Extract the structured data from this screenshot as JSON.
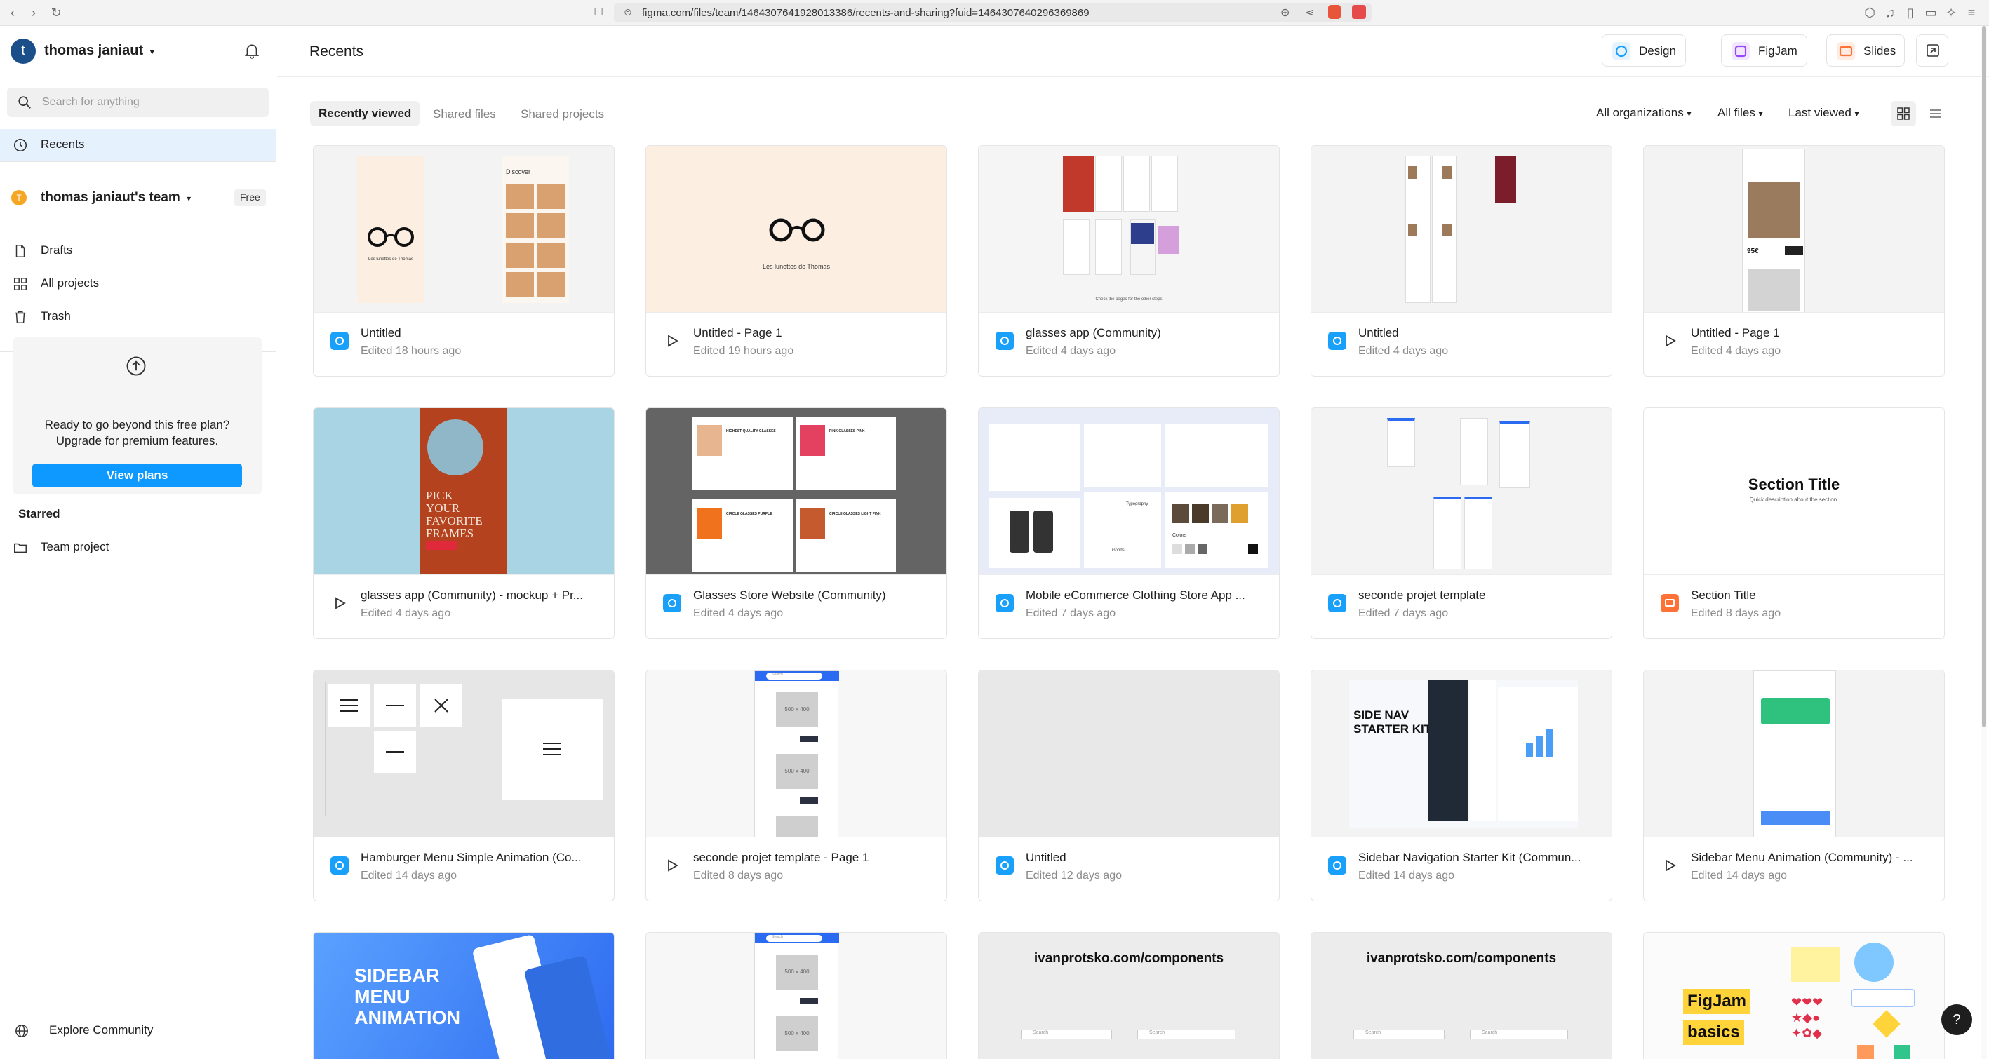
{
  "browser": {
    "url": "figma.com/files/team/1464307641928013386/recents-and-sharing?fuid=1464307640296369869"
  },
  "sidebar": {
    "user_initial": "t",
    "user_name": "thomas janiaut",
    "search_placeholder": "Search for anything",
    "recents_label": "Recents",
    "team_initial": "T",
    "team_name": "thomas janiaut's team",
    "team_badge": "Free",
    "items": [
      {
        "label": "Drafts"
      },
      {
        "label": "All projects"
      },
      {
        "label": "Trash"
      }
    ],
    "upgrade": {
      "line1": "Ready to go beyond this free plan?",
      "line2": "Upgrade for premium features.",
      "button": "View plans"
    },
    "starred_heading": "Starred",
    "starred_items": [
      {
        "label": "Team project"
      }
    ],
    "explore_label": "Explore Community"
  },
  "header": {
    "title": "Recents",
    "buttons": [
      {
        "label": "Design",
        "color": "#18a0fb"
      },
      {
        "label": "FigJam",
        "color": "#9747ff"
      },
      {
        "label": "Slides",
        "color": "#ff7237"
      }
    ]
  },
  "tabs": [
    {
      "label": "Recently viewed",
      "active": true
    },
    {
      "label": "Shared files",
      "active": false
    },
    {
      "label": "Shared projects",
      "active": false
    }
  ],
  "filters": {
    "org": "All organizations",
    "files": "All files",
    "sort": "Last viewed"
  },
  "files": [
    {
      "title": "Untitled",
      "edited": "Edited 18 hours ago",
      "kind": "design"
    },
    {
      "title": "Untitled - Page 1",
      "edited": "Edited 19 hours ago",
      "kind": "prototype"
    },
    {
      "title": "glasses app (Community)",
      "edited": "Edited 4 days ago",
      "kind": "design"
    },
    {
      "title": "Untitled",
      "edited": "Edited 4 days ago",
      "kind": "design"
    },
    {
      "title": "Untitled - Page 1",
      "edited": "Edited 4 days ago",
      "kind": "prototype"
    },
    {
      "title": "glasses app (Community) - mockup + Pr...",
      "edited": "Edited 4 days ago",
      "kind": "prototype"
    },
    {
      "title": "Glasses Store Website (Community)",
      "edited": "Edited 4 days ago",
      "kind": "design"
    },
    {
      "title": "Mobile eCommerce Clothing Store App ...",
      "edited": "Edited 7 days ago",
      "kind": "design"
    },
    {
      "title": "seconde projet template",
      "edited": "Edited 7 days ago",
      "kind": "design"
    },
    {
      "title": "Section Title",
      "edited": "Edited 8 days ago",
      "kind": "slides"
    },
    {
      "title": "Hamburger Menu Simple Animation (Co...",
      "edited": "Edited 14 days ago",
      "kind": "design"
    },
    {
      "title": "seconde projet template - Page 1",
      "edited": "Edited 8 days ago",
      "kind": "prototype"
    },
    {
      "title": "Untitled",
      "edited": "Edited 12 days ago",
      "kind": "design"
    },
    {
      "title": "Sidebar Navigation Starter Kit (Commun...",
      "edited": "Edited 14 days ago",
      "kind": "design"
    },
    {
      "title": "Sidebar Menu Animation (Community) - ...",
      "edited": "Edited 14 days ago",
      "kind": "prototype"
    }
  ],
  "thumb_text": {
    "brand": "Les lunettes de Thomas",
    "discover": "Discover",
    "pick": [
      "PICK",
      "YOUR",
      "FAVORITE",
      "FRAMES"
    ],
    "section_title": "Section Title",
    "section_desc": "Quick description about the section.",
    "side_nav": [
      "SIDE NAV",
      "STARTER KIT"
    ],
    "sidebar_anim": [
      "SIDEBAR",
      "MENU",
      "ANIMATION"
    ],
    "ivan": "ivanprotsko.com/components",
    "figjam_basics": [
      "FigJam",
      "basics"
    ],
    "placeholder_img": "500 x 400",
    "price": "95€",
    "check_pages": "Check the pages  for the other steps",
    "search": "Search",
    "ecom_labels": [
      "Colors",
      "Typography",
      "Goods"
    ],
    "shirt_titles": [
      "HIGHEST QUALITY GLASSES",
      "PINK GLASSES PINK",
      "CIRCLE GLASSES PURPLE",
      "CIRCLE GLASSES LIGHT PINK"
    ]
  }
}
